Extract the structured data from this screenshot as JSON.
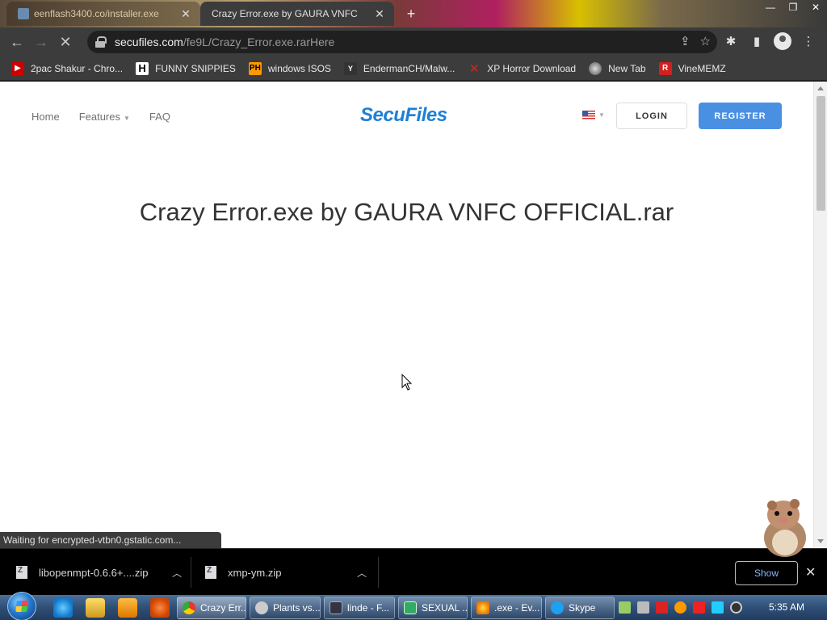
{
  "browser": {
    "tabs": [
      {
        "title": "eenflash3400.co/installer.exe",
        "active": false
      },
      {
        "title": "Crazy Error.exe by GAURA VNFC",
        "active": true
      }
    ],
    "new_tab_label": "+",
    "url_host": "secufiles.com",
    "url_path": "/fe9L/Crazy_Error.exe.rarHere",
    "bookmarks": [
      {
        "label": "2pac Shakur - Chro...",
        "icon": "youtube-icon"
      },
      {
        "label": "FUNNY SNIPPIES",
        "icon": "h-icon"
      },
      {
        "label": "windows ISOS",
        "icon": "ph-icon"
      },
      {
        "label": "EndermanCH/Malw...",
        "icon": "y-icon"
      },
      {
        "label": "XP Horror Download",
        "icon": "x-icon"
      },
      {
        "label": "New Tab",
        "icon": "globe-icon"
      },
      {
        "label": "VineMEMZ",
        "icon": "r-icon"
      }
    ],
    "status_text": "Waiting for encrypted-vtbn0.gstatic.com..."
  },
  "site": {
    "nav": {
      "home": "Home",
      "features": "Features",
      "faq": "FAQ"
    },
    "logo": "SecuFiles",
    "login": "LOGIN",
    "register": "REGISTER",
    "file_title": "Crazy Error.exe by GAURA VNFC OFFICIAL.rar"
  },
  "downloads": {
    "items": [
      {
        "name": "libopenmpt-0.6.6+....zip"
      },
      {
        "name": "xmp-ym.zip"
      }
    ],
    "show_all": "Show"
  },
  "taskbar": {
    "buttons": [
      {
        "label": "Crazy Err..."
      },
      {
        "label": "Plants vs..."
      },
      {
        "label": "linde - F..."
      },
      {
        "label": "SEXUAL ..."
      },
      {
        "label": ".exe - Ev..."
      },
      {
        "label": "Skype"
      }
    ],
    "clock": "5:35 AM"
  },
  "colors": {
    "brand": "#1e7fd6",
    "register_bg": "#4a90e2",
    "chrome_dark": "#3c3c3c"
  }
}
